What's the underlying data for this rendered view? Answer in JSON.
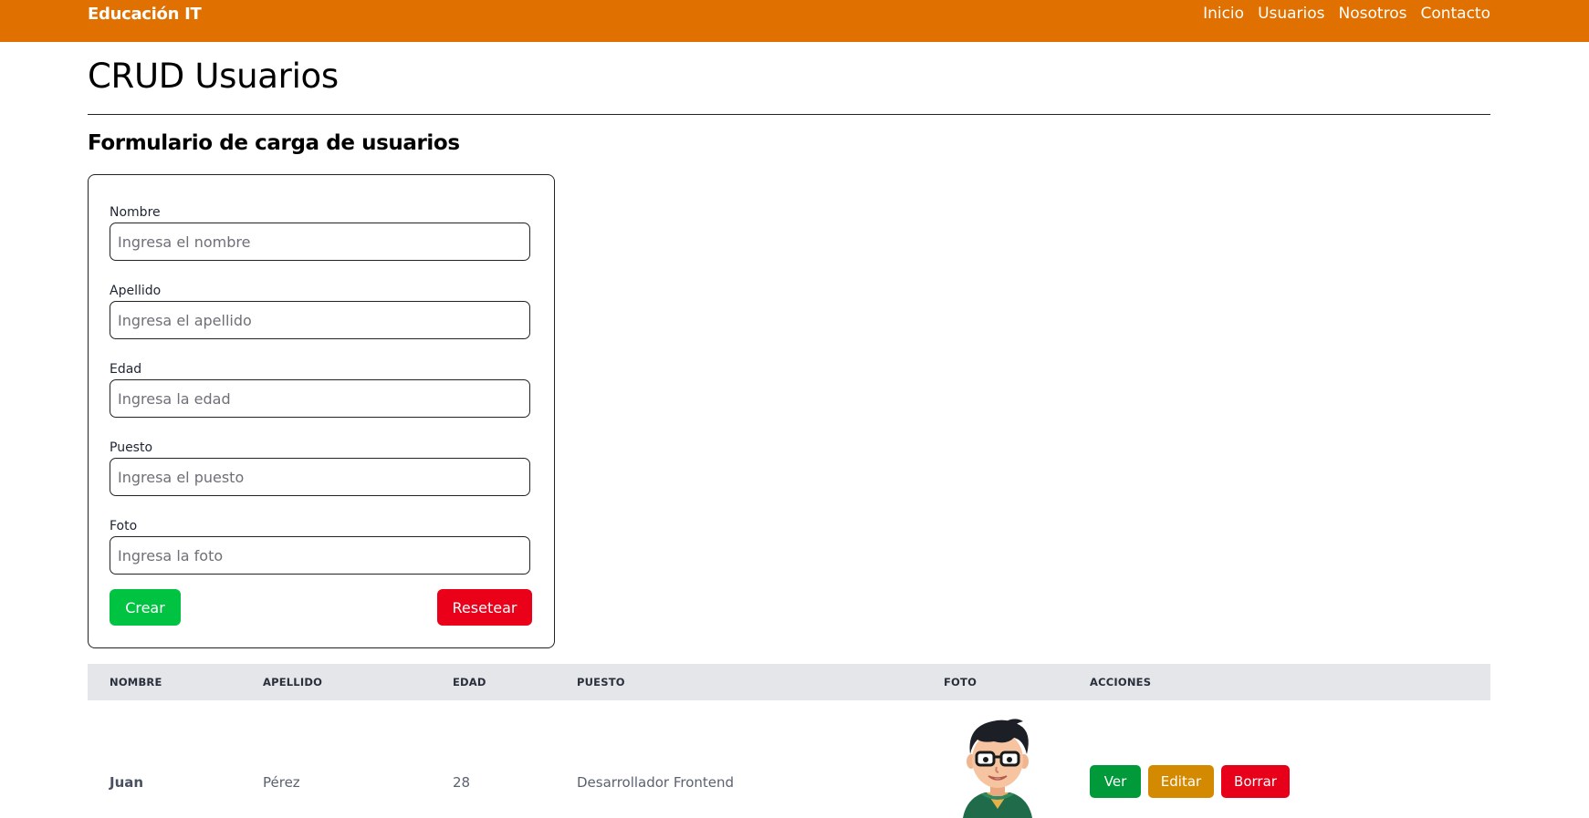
{
  "navbar": {
    "brand": "Educación IT",
    "links": [
      "Inicio",
      "Usuarios",
      "Nosotros",
      "Contacto"
    ],
    "bg_color": "#e07000"
  },
  "page": {
    "title": "CRUD Usuarios",
    "section_title": "Formulario de carga de usuarios"
  },
  "form": {
    "fields": [
      {
        "label": "Nombre",
        "placeholder": "Ingresa el nombre",
        "value": ""
      },
      {
        "label": "Apellido",
        "placeholder": "Ingresa el apellido",
        "value": ""
      },
      {
        "label": "Edad",
        "placeholder": "Ingresa la edad",
        "value": ""
      },
      {
        "label": "Puesto",
        "placeholder": "Ingresa el puesto",
        "value": ""
      },
      {
        "label": "Foto",
        "placeholder": "Ingresa la foto",
        "value": ""
      }
    ],
    "create_label": "Crear",
    "reset_label": "Resetear"
  },
  "table": {
    "headers": [
      "NOMBRE",
      "APELLIDO",
      "EDAD",
      "PUESTO",
      "FOTO",
      "ACCIONES"
    ],
    "rows": [
      {
        "nombre": "Juan",
        "apellido": "Pérez",
        "edad": "28",
        "puesto": "Desarrollador Frontend",
        "foto_icon": "cartoon-avatar-glasses",
        "actions": {
          "view": "Ver",
          "edit": "Editar",
          "delete": "Borrar"
        }
      }
    ]
  },
  "colors": {
    "create": "#00c341",
    "reset": "#ea0018",
    "view": "#009a3a",
    "edit": "#d38a00",
    "delete": "#e8001a"
  }
}
